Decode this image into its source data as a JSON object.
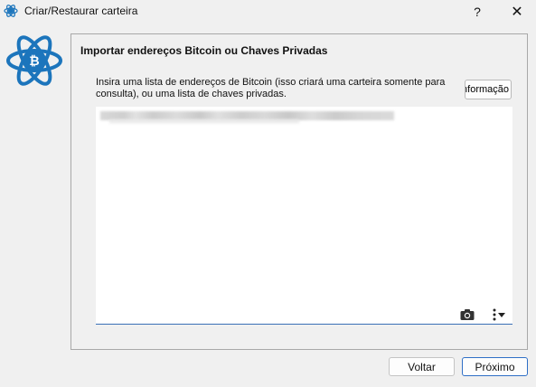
{
  "window": {
    "title": "Criar/Restaurar carteira",
    "help_label": "?",
    "close_label": "✕"
  },
  "panel": {
    "title": "Importar endereços Bitcoin ou Chaves Privadas",
    "instructions": "Insira uma lista de endereços de Bitcoin (isso criará uma carteira somente para consulta), ou uma lista de chaves privadas.",
    "info_button_label": "Informação"
  },
  "editor": {
    "value": "",
    "camera_icon": "camera-icon",
    "menu_icon": "more-options-icon"
  },
  "footer": {
    "back_label": "Voltar",
    "next_label": "Próximo"
  },
  "colors": {
    "accent": "#2f6fc6",
    "logo_blue": "#1c75bc",
    "background": "#f0f0f0"
  }
}
